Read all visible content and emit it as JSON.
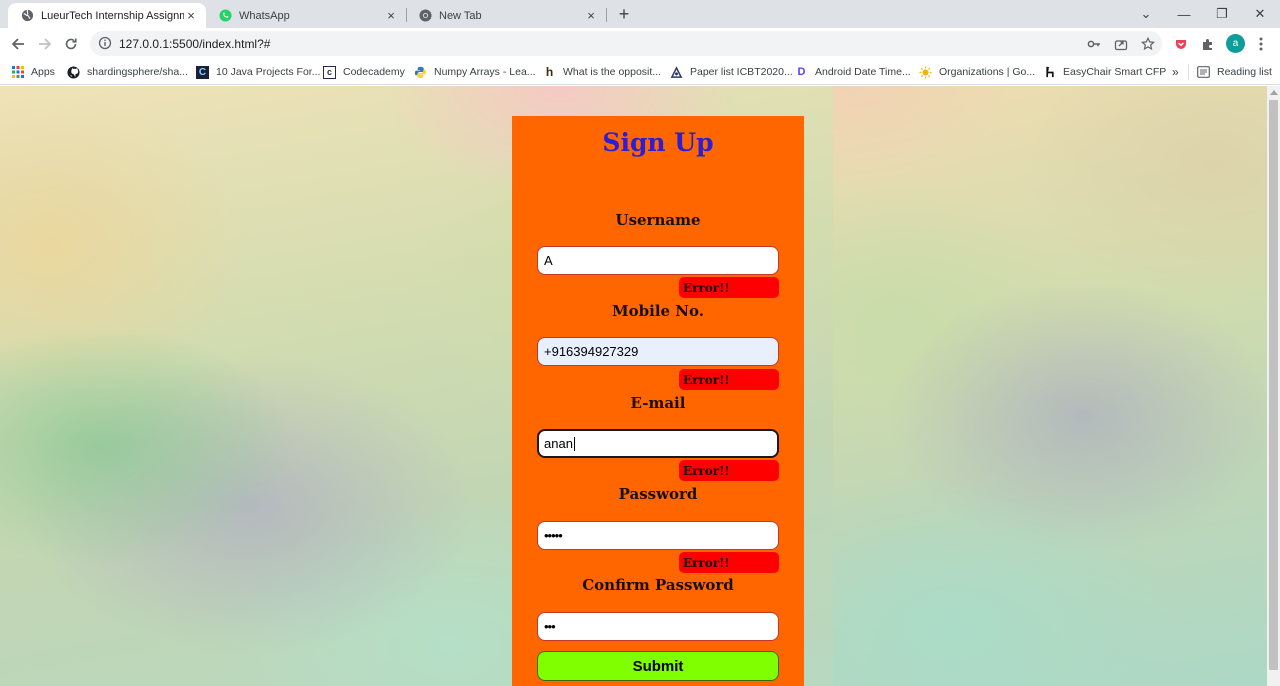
{
  "browser": {
    "tabs": [
      {
        "title": "LueurTech Internship Assignment",
        "icon": "globe-icon",
        "active": true
      },
      {
        "title": "WhatsApp",
        "icon": "whatsapp-icon",
        "active": false
      },
      {
        "title": "New Tab",
        "icon": "chrome-icon",
        "active": false
      }
    ],
    "close_glyph": "×",
    "new_tab_glyph": "+",
    "window_controls": {
      "menu": "⌄",
      "minimize": "—",
      "restore": "❐",
      "close": "✕"
    },
    "address": "127.0.0.1:5500/index.html?#",
    "avatar_letter": "a"
  },
  "bookmarks": {
    "items": [
      {
        "label": "Apps",
        "icon": "apps-icon"
      },
      {
        "label": "shardingsphere/sha...",
        "icon": "github-icon"
      },
      {
        "label": "10 Java Projects For...",
        "icon": "c-icon"
      },
      {
        "label": "Codecademy",
        "icon": "codecademy-icon"
      },
      {
        "label": "Numpy Arrays - Lea...",
        "icon": "python-icon"
      },
      {
        "label": "What is the opposit...",
        "icon": "h-icon"
      },
      {
        "label": "Paper list ICBT2020...",
        "icon": "paper-icon"
      },
      {
        "label": "Android Date Time...",
        "icon": "dd-icon"
      },
      {
        "label": "Organizations | Go...",
        "icon": "sun-icon"
      },
      {
        "label": "EasyChair Smart CFP",
        "icon": "easychair-icon"
      }
    ],
    "overflow": "»",
    "reading_list": "Reading list"
  },
  "form": {
    "title": "Sign Up",
    "fields": {
      "username": {
        "label": "Username",
        "value": "A",
        "error": "Error!!"
      },
      "mobile": {
        "label": "Mobile No.",
        "value": "+916394927329",
        "error": "Error!!"
      },
      "email": {
        "label": "E-mail",
        "value": "anan",
        "error": "Error!!"
      },
      "password": {
        "label": "Password",
        "value": "•••••",
        "error": "Error!!"
      },
      "confirm": {
        "label": "Confirm Password",
        "value": "•••"
      }
    },
    "submit_label": "Submit"
  },
  "colors": {
    "card": "#ff6600",
    "title": "#2a1fd6",
    "error": "#ff0000",
    "submit": "#7fff00"
  }
}
